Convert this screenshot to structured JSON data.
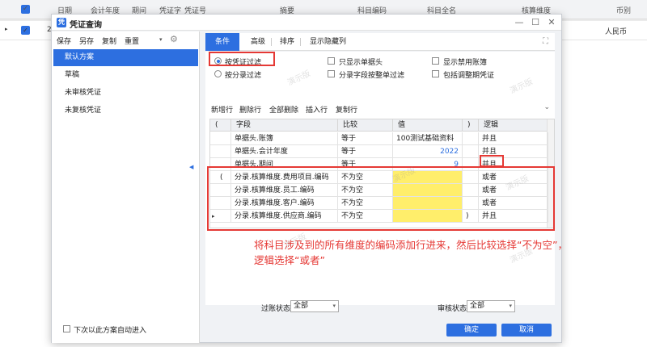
{
  "background": {
    "columns": [
      "日期",
      "会计年度",
      "期间",
      "凭证字",
      "凭证号",
      "摘要",
      "科目编码",
      "科目全名",
      "核算维度",
      "币别"
    ],
    "row": {
      "indicator": "▸",
      "num": "2",
      "currency": "人民币"
    }
  },
  "dialog": {
    "title": "凭证查询",
    "controls": {
      "minimize": "—",
      "maximize": "☐",
      "close": "✕"
    }
  },
  "left": {
    "toolbar": [
      "保存",
      "另存",
      "复制",
      "重置"
    ],
    "schemes": [
      "默认方案",
      "草稿",
      "未审核凭证",
      "未复核凭证"
    ],
    "active_scheme": 0,
    "auto_enter_label": "下次以此方案自动进入"
  },
  "tabs": [
    "条件",
    "高级",
    "排序",
    "显示隐藏列"
  ],
  "active_tab": 0,
  "options": {
    "by_voucher": "按凭证过滤",
    "by_entry": "按分录过滤",
    "header_only": "只显示单据头",
    "entry_field_filter": "分录字段按整单过滤",
    "show_disabled_books": "显示禁用账簿",
    "include_adjust": "包括调整期凭证"
  },
  "grid_toolbar": [
    "新增行",
    "删除行",
    "全部删除",
    "插入行",
    "复制行"
  ],
  "grid": {
    "headers": [
      "(",
      "字段",
      "比较",
      "值",
      ")",
      "逻辑"
    ],
    "rows": [
      {
        "open": "",
        "field": "单据头.账簿",
        "compare": "等于",
        "value": "100测试基础资料",
        "close": "",
        "logic": "并且",
        "yellow": false,
        "numeric": false,
        "current": false
      },
      {
        "open": "",
        "field": "单据头.会计年度",
        "compare": "等于",
        "value": "2022",
        "close": "",
        "logic": "并且",
        "yellow": false,
        "numeric": true,
        "current": false
      },
      {
        "open": "",
        "field": "单据头.期间",
        "compare": "等于",
        "value": "9",
        "close": "",
        "logic": "并且",
        "yellow": false,
        "numeric": true,
        "current": false
      },
      {
        "open": "(",
        "field": "分录.核算维度.费用项目.编码",
        "compare": "不为空",
        "value": "",
        "close": "",
        "logic": "或者",
        "yellow": true,
        "numeric": false,
        "current": false
      },
      {
        "open": "",
        "field": "分录.核算维度.员工.编码",
        "compare": "不为空",
        "value": "",
        "close": "",
        "logic": "或者",
        "yellow": true,
        "numeric": false,
        "current": false
      },
      {
        "open": "",
        "field": "分录.核算维度.客户.编码",
        "compare": "不为空",
        "value": "",
        "close": "",
        "logic": "或者",
        "yellow": true,
        "numeric": false,
        "current": false
      },
      {
        "open": "",
        "field": "分录.核算维度.供应商.编码",
        "compare": "不为空",
        "value": "",
        "close": ")",
        "logic": "并且",
        "yellow": true,
        "numeric": false,
        "current": true
      }
    ]
  },
  "annotation": "将科目涉及到的所有维度的编码添加行进来，然后比较选择“不为空”，逻辑选择“或者”",
  "filters": {
    "post_label": "过账状态",
    "post_value": "全部",
    "audit_label": "审核状态",
    "audit_value": "全部"
  },
  "buttons": {
    "ok": "确定",
    "cancel": "取消"
  },
  "watermark": "演示版",
  "colors": {
    "accent": "#2d6fe0",
    "annotation": "#e53935",
    "highlight": "#ffee6b"
  }
}
